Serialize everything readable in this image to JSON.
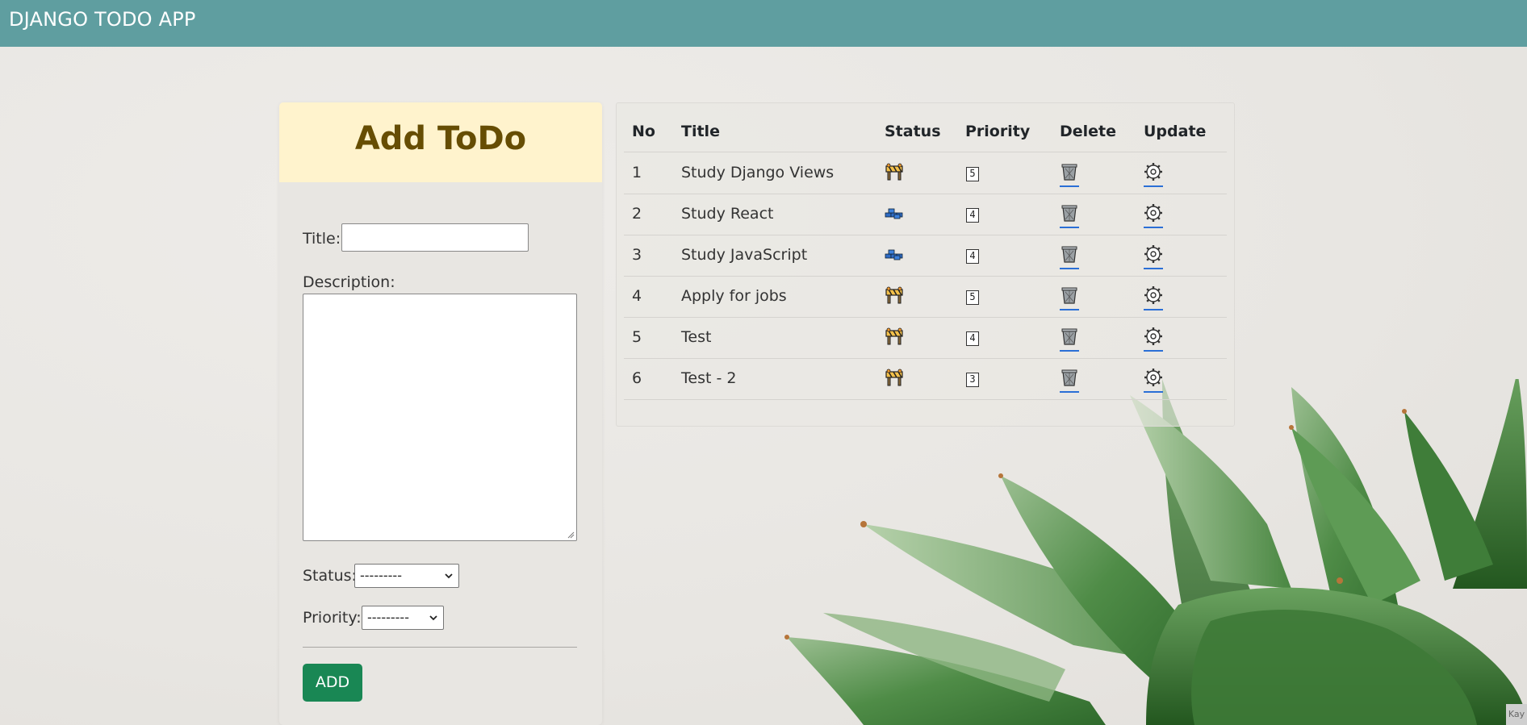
{
  "navbar": {
    "brand": "DJANGO TODO APP"
  },
  "form": {
    "heading": "Add ToDo",
    "title_label": "Title:",
    "title_value": "",
    "description_label": "Description:",
    "description_value": "",
    "status_label": "Status:",
    "status_selected": "---------",
    "priority_label": "Priority:",
    "priority_selected": "---------",
    "submit_label": "ADD"
  },
  "table": {
    "headers": [
      "No",
      "Title",
      "Status",
      "Priority",
      "Delete",
      "Update"
    ],
    "rows": [
      {
        "no": "1",
        "title": "Study Django Views",
        "status_icon": "construction-barrier-icon",
        "priority": "5"
      },
      {
        "no": "2",
        "title": "Study React",
        "status_icon": "bricks-icon",
        "priority": "4"
      },
      {
        "no": "3",
        "title": "Study JavaScript",
        "status_icon": "bricks-icon",
        "priority": "4"
      },
      {
        "no": "4",
        "title": "Apply for jobs",
        "status_icon": "construction-barrier-icon",
        "priority": "5"
      },
      {
        "no": "5",
        "title": "Test",
        "status_icon": "construction-barrier-icon",
        "priority": "4"
      },
      {
        "no": "6",
        "title": "Test - 2",
        "status_icon": "construction-barrier-icon",
        "priority": "3"
      }
    ],
    "delete_icon": "wastebasket-icon",
    "update_icon": "gear-icon"
  },
  "colors": {
    "navbar": "#5f9ea0",
    "card_header_bg": "#fff3cd",
    "card_header_text": "#664d03",
    "add_button": "#198754",
    "page_bg": "#e9e7e3",
    "link_underline": "#2b6fd6"
  },
  "corner_tag": "Kay"
}
